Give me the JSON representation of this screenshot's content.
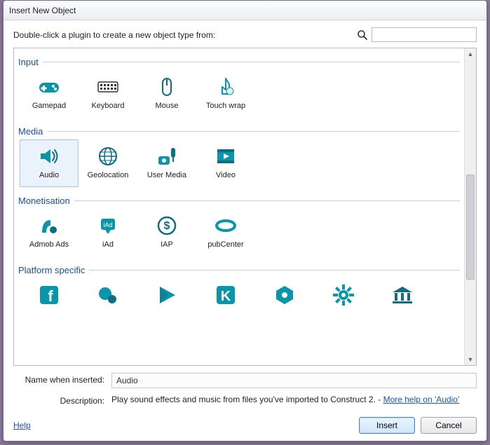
{
  "window": {
    "title": "Insert New Object"
  },
  "instruction": "Double-click a plugin to create a new object type from:",
  "search": {
    "placeholder": "",
    "value": ""
  },
  "categories": [
    {
      "name": "Input",
      "items": [
        {
          "label": "Gamepad",
          "icon": "gamepad-icon"
        },
        {
          "label": "Keyboard",
          "icon": "keyboard-icon"
        },
        {
          "label": "Mouse",
          "icon": "mouse-icon"
        },
        {
          "label": "Touch wrap",
          "icon": "touchwrap-icon"
        }
      ]
    },
    {
      "name": "Media",
      "items": [
        {
          "label": "Audio",
          "icon": "audio-icon",
          "selected": true
        },
        {
          "label": "Geolocation",
          "icon": "geolocation-icon"
        },
        {
          "label": "User Media",
          "icon": "usermedia-icon"
        },
        {
          "label": "Video",
          "icon": "video-icon"
        }
      ]
    },
    {
      "name": "Monetisation",
      "items": [
        {
          "label": "Admob Ads",
          "icon": "admob-icon"
        },
        {
          "label": "iAd",
          "icon": "iad-icon"
        },
        {
          "label": "IAP",
          "icon": "iap-icon"
        },
        {
          "label": "pubCenter",
          "icon": "pubcenter-icon"
        }
      ]
    },
    {
      "name": "Platform specific",
      "items": [
        {
          "label": "",
          "icon": "facebook-icon"
        },
        {
          "label": "",
          "icon": "circles-icon"
        },
        {
          "label": "",
          "icon": "play-icon"
        },
        {
          "label": "",
          "icon": "k-icon"
        },
        {
          "label": "",
          "icon": "hex-icon"
        },
        {
          "label": "",
          "icon": "gear-icon"
        },
        {
          "label": "",
          "icon": "bank-icon"
        }
      ]
    }
  ],
  "form": {
    "name_label": "Name when inserted:",
    "name_value": "Audio",
    "desc_label": "Description:",
    "desc_text": "Play sound effects and music from files you've imported to Construct 2. - ",
    "desc_link": "More help on 'Audio'"
  },
  "footer": {
    "help": "Help",
    "insert": "Insert",
    "cancel": "Cancel"
  },
  "colors": {
    "accent": "#0a96aa",
    "accent2": "#0d6e80"
  }
}
